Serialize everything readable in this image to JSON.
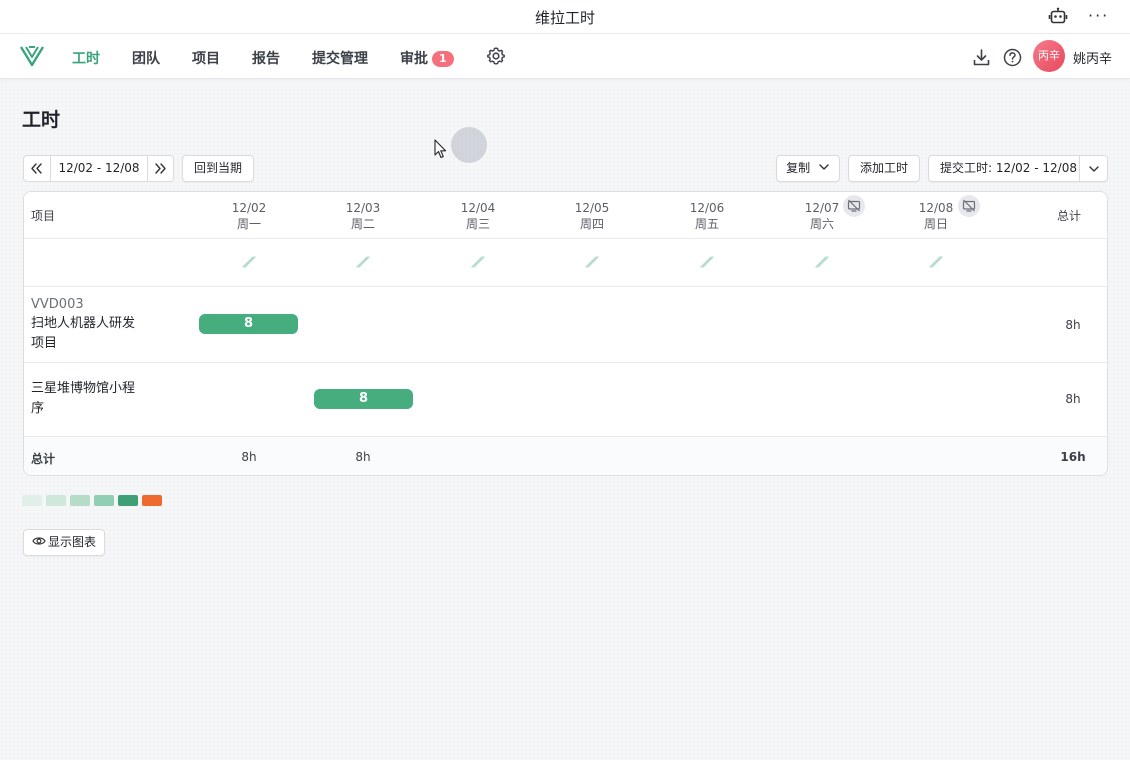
{
  "window": {
    "title": "维拉工时"
  },
  "nav": {
    "items": [
      {
        "label": "工时",
        "active": true
      },
      {
        "label": "团队"
      },
      {
        "label": "项目"
      },
      {
        "label": "报告"
      },
      {
        "label": "提交管理"
      },
      {
        "label": "审批",
        "badge": "1"
      }
    ],
    "avatar_text": "丙辛",
    "username": "姚丙辛"
  },
  "page": {
    "title": "工时"
  },
  "toolbar": {
    "date_range": "12/02 - 12/08",
    "back_to_current": "回到当期",
    "copy": "复制",
    "add_time": "添加工时",
    "submit": "提交工时: 12/02 - 12/08"
  },
  "table": {
    "project_header": "项目",
    "total_header": "总计",
    "days": [
      {
        "date": "12/02",
        "weekday": "周一"
      },
      {
        "date": "12/03",
        "weekday": "周二"
      },
      {
        "date": "12/04",
        "weekday": "周三"
      },
      {
        "date": "12/05",
        "weekday": "周四"
      },
      {
        "date": "12/06",
        "weekday": "周五"
      },
      {
        "date": "12/07",
        "weekday": "周六",
        "no_sync": true
      },
      {
        "date": "12/08",
        "weekday": "周日",
        "no_sync": true
      }
    ],
    "rows": [
      {
        "code": "VVD003",
        "name": "扫地人机器人研发项目",
        "entries": [
          {
            "day": "12/02",
            "hours": "8"
          }
        ],
        "total": "8h"
      },
      {
        "name": "三星堆博物馆小程序",
        "entries": [
          {
            "day": "12/03",
            "hours": "8"
          }
        ],
        "total": "8h"
      }
    ],
    "footer": {
      "label": "总计",
      "day_totals": [
        "8h",
        "8h"
      ],
      "grand_total": "16h"
    }
  },
  "legend_colors": [
    "#e2efe9",
    "#cfe8dc",
    "#b5dcc9",
    "#92ceb2",
    "#3fa077",
    "#ef6a2f"
  ],
  "show_chart": "显示图表"
}
